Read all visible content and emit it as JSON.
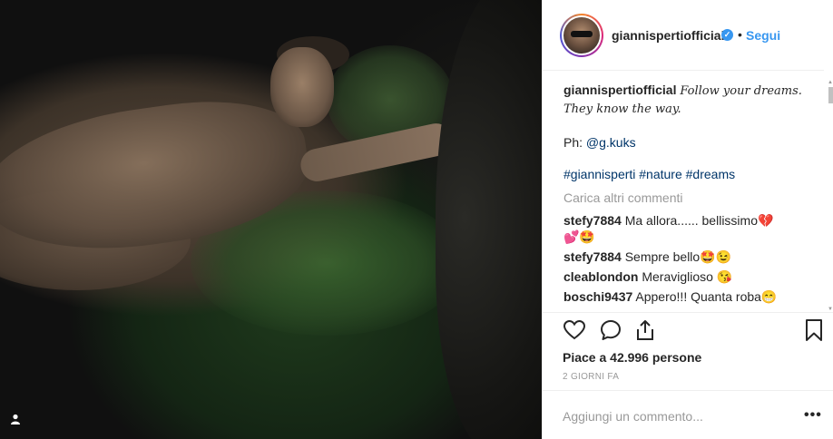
{
  "post": {
    "username": "giannispertiofficial",
    "follow_label": "Segui",
    "separator": "•",
    "verified_mark": "✓",
    "user_tag_icon": "person-icon"
  },
  "caption": {
    "username": "giannispertiofficial",
    "text": "Follow your dreams. They know the way.",
    "ph_label": "Ph:",
    "ph_link": "@g.kuks",
    "hashtags": "#giannisperti #nature #dreams"
  },
  "load_more": "Carica altri commenti",
  "comments": [
    {
      "user": "stefy7884",
      "text": "Ma allora...... bellissimo💔 💕🤩"
    },
    {
      "user": "stefy7884",
      "text": "Sempre bello🤩😉"
    },
    {
      "user": "cleablondon",
      "text": "Meraviglioso 😘"
    },
    {
      "user": "boschi9437",
      "text": "Appero!!! Quanta roba😁"
    }
  ],
  "likes": "Piace a 42.996 persone",
  "time": "2 GIORNI FA",
  "add_comment_placeholder": "Aggiungi un commento...",
  "more_label": "•••",
  "colors": {
    "accent": "#3897f0",
    "link": "#003569",
    "muted": "#999999",
    "text": "#262626"
  }
}
